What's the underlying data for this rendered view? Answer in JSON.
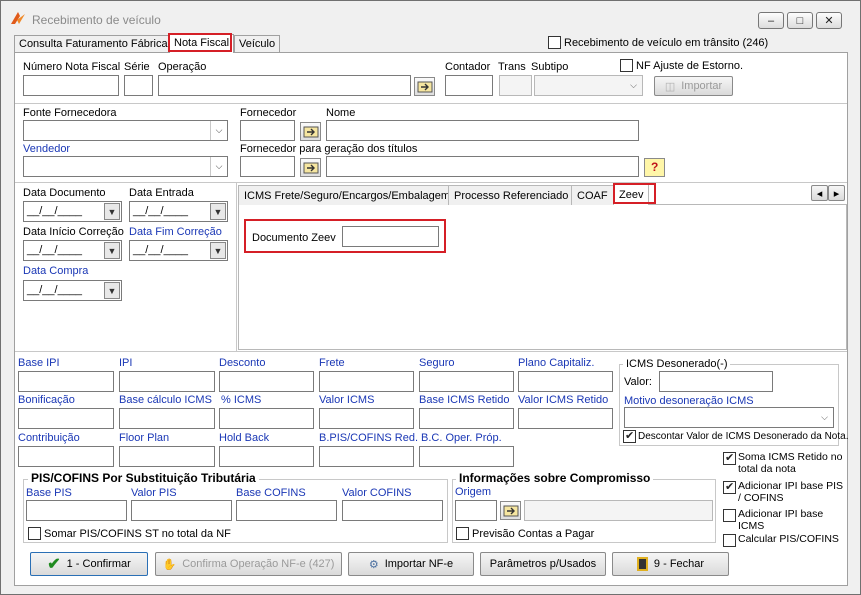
{
  "window": {
    "title": "Recebimento de veículo",
    "minimize": "–",
    "maximize": "□",
    "close": "✕"
  },
  "tabs": [
    "Consulta Faturamento Fábrica",
    "Nota Fiscal",
    "Veículo"
  ],
  "transit_checkbox": {
    "label": "Recebimento de veículo em trânsito (246)",
    "checked": false
  },
  "header": {
    "numero_nf": "Número Nota Fiscal",
    "serie": "Série",
    "operacao": "Operação",
    "contador": "Contador",
    "trans": "Trans",
    "subtipo": "Subtipo",
    "nf_ajuste": "NF Ajuste  de Estorno.",
    "importar": "Importar"
  },
  "supplier": {
    "fonte_fornecedora": "Fonte Fornecedora",
    "fornecedor": "Fornecedor",
    "nome": "Nome",
    "vendedor": "Vendedor",
    "fornecedor_titulos": "Fornecedor para geração dos títulos",
    "help": "?"
  },
  "dates": {
    "data_documento": "Data Documento",
    "data_entrada": "Data Entrada",
    "data_inicio_correcao": "Data Início Correção",
    "data_fim_correcao": "Data Fim Correção",
    "data_compra": "Data Compra",
    "placeholder": "__/__/____"
  },
  "inner_tabs": [
    "ICMS Frete/Seguro/Encargos/Embalagem",
    "Processo Referenciado",
    "COAF",
    "Zeev"
  ],
  "inner_nav": {
    "prev": "◂",
    "next": "▸"
  },
  "zeev": {
    "documento_label": "Documento Zeev",
    "documento_value": ""
  },
  "taxes": {
    "row1": [
      "Base IPI",
      "IPI",
      "Desconto",
      "Frete",
      "Seguro",
      "Plano Capitaliz."
    ],
    "row2": [
      "Bonificação",
      "Base cálculo ICMS",
      "% ICMS",
      "Valor ICMS",
      "Base ICMS Retido",
      "Valor ICMS Retido"
    ],
    "row3": [
      "Contribuição",
      "Floor Plan",
      "Hold Back",
      "B.PIS/COFINS Red.",
      "B.C. Oper. Próp."
    ]
  },
  "icms_desonerado": {
    "title": "ICMS Desonerado(-)",
    "valor": "Valor:",
    "motivo": "Motivo desoneração ICMS",
    "descontar": "Descontar Valor de ICMS Desonerado da Nota."
  },
  "pis_cofins": {
    "title": "PIS/COFINS Por Substituição Tributária",
    "fields": [
      "Base PIS",
      "Valor PIS",
      "Base COFINS",
      "Valor COFINS"
    ],
    "somar": "Somar PIS/COFINS ST no total da NF"
  },
  "compromisso": {
    "title": "Informações sobre Compromisso",
    "origem": "Origem",
    "previsao": "Previsão Contas a Pagar"
  },
  "side_checks": [
    {
      "label": "Soma ICMS Retido no total da nota",
      "checked": true
    },
    {
      "label": "Adicionar IPI base PIS / COFINS",
      "checked": true
    },
    {
      "label": "Adicionar IPI base ICMS",
      "checked": false
    },
    {
      "label": "Calcular PIS/COFINS",
      "checked": false
    }
  ],
  "buttons": {
    "confirmar": "1 - Confirmar",
    "confirma_nfe": "Confirma Operação NF-e  (427)",
    "importar_nfe": "Importar  NF-e",
    "parametros": "Parâmetros p/Usados",
    "fechar": "9 - Fechar"
  },
  "colors": {
    "highlight": "#d51f26",
    "blue_label": "#1a37b5"
  }
}
